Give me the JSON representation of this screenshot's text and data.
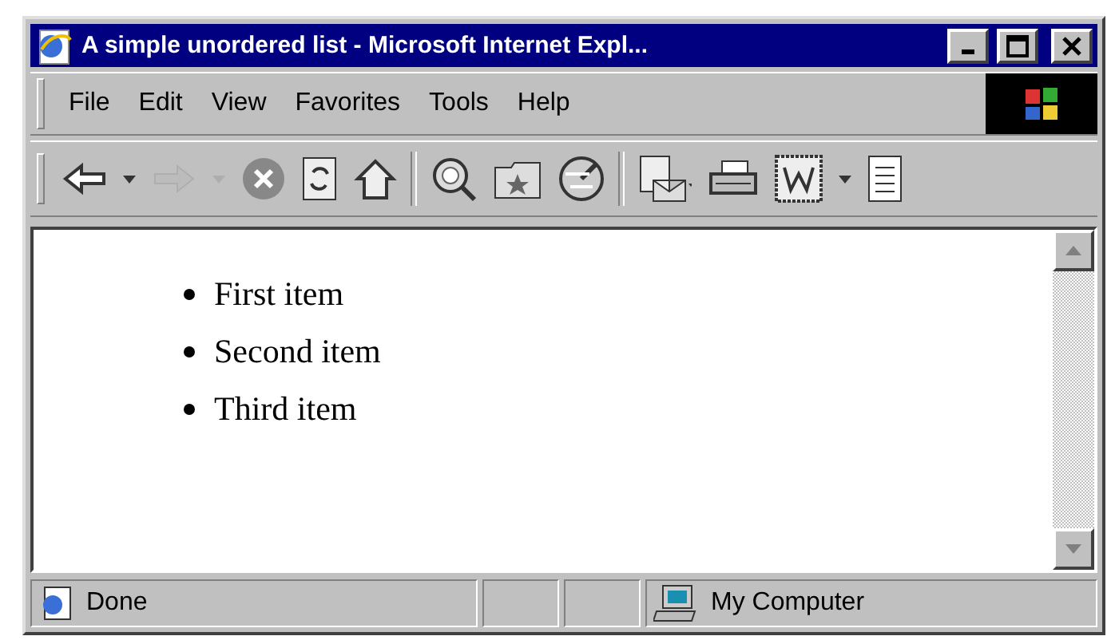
{
  "window": {
    "title": "A simple unordered list - Microsoft Internet Expl..."
  },
  "menu": [
    "File",
    "Edit",
    "View",
    "Favorites",
    "Tools",
    "Help"
  ],
  "toolbar": [
    {
      "kind": "back",
      "disabled": false
    },
    {
      "kind": "caret",
      "disabled": false
    },
    {
      "kind": "forward",
      "disabled": true
    },
    {
      "kind": "caret",
      "disabled": true
    },
    {
      "kind": "stop",
      "disabled": false
    },
    {
      "kind": "refresh",
      "disabled": false
    },
    {
      "kind": "home",
      "disabled": false
    },
    {
      "kind": "sep"
    },
    {
      "kind": "search",
      "disabled": false
    },
    {
      "kind": "favorites",
      "disabled": false
    },
    {
      "kind": "history",
      "disabled": false
    },
    {
      "kind": "sep"
    },
    {
      "kind": "mail",
      "disabled": false
    },
    {
      "kind": "print",
      "disabled": false
    },
    {
      "kind": "edit",
      "disabled": false
    },
    {
      "kind": "caret",
      "disabled": false
    },
    {
      "kind": "discuss",
      "disabled": false
    }
  ],
  "content": {
    "items": [
      "First item",
      "Second item",
      "Third item"
    ]
  },
  "status_bar": {
    "text": "Done",
    "zone": "My Computer"
  }
}
